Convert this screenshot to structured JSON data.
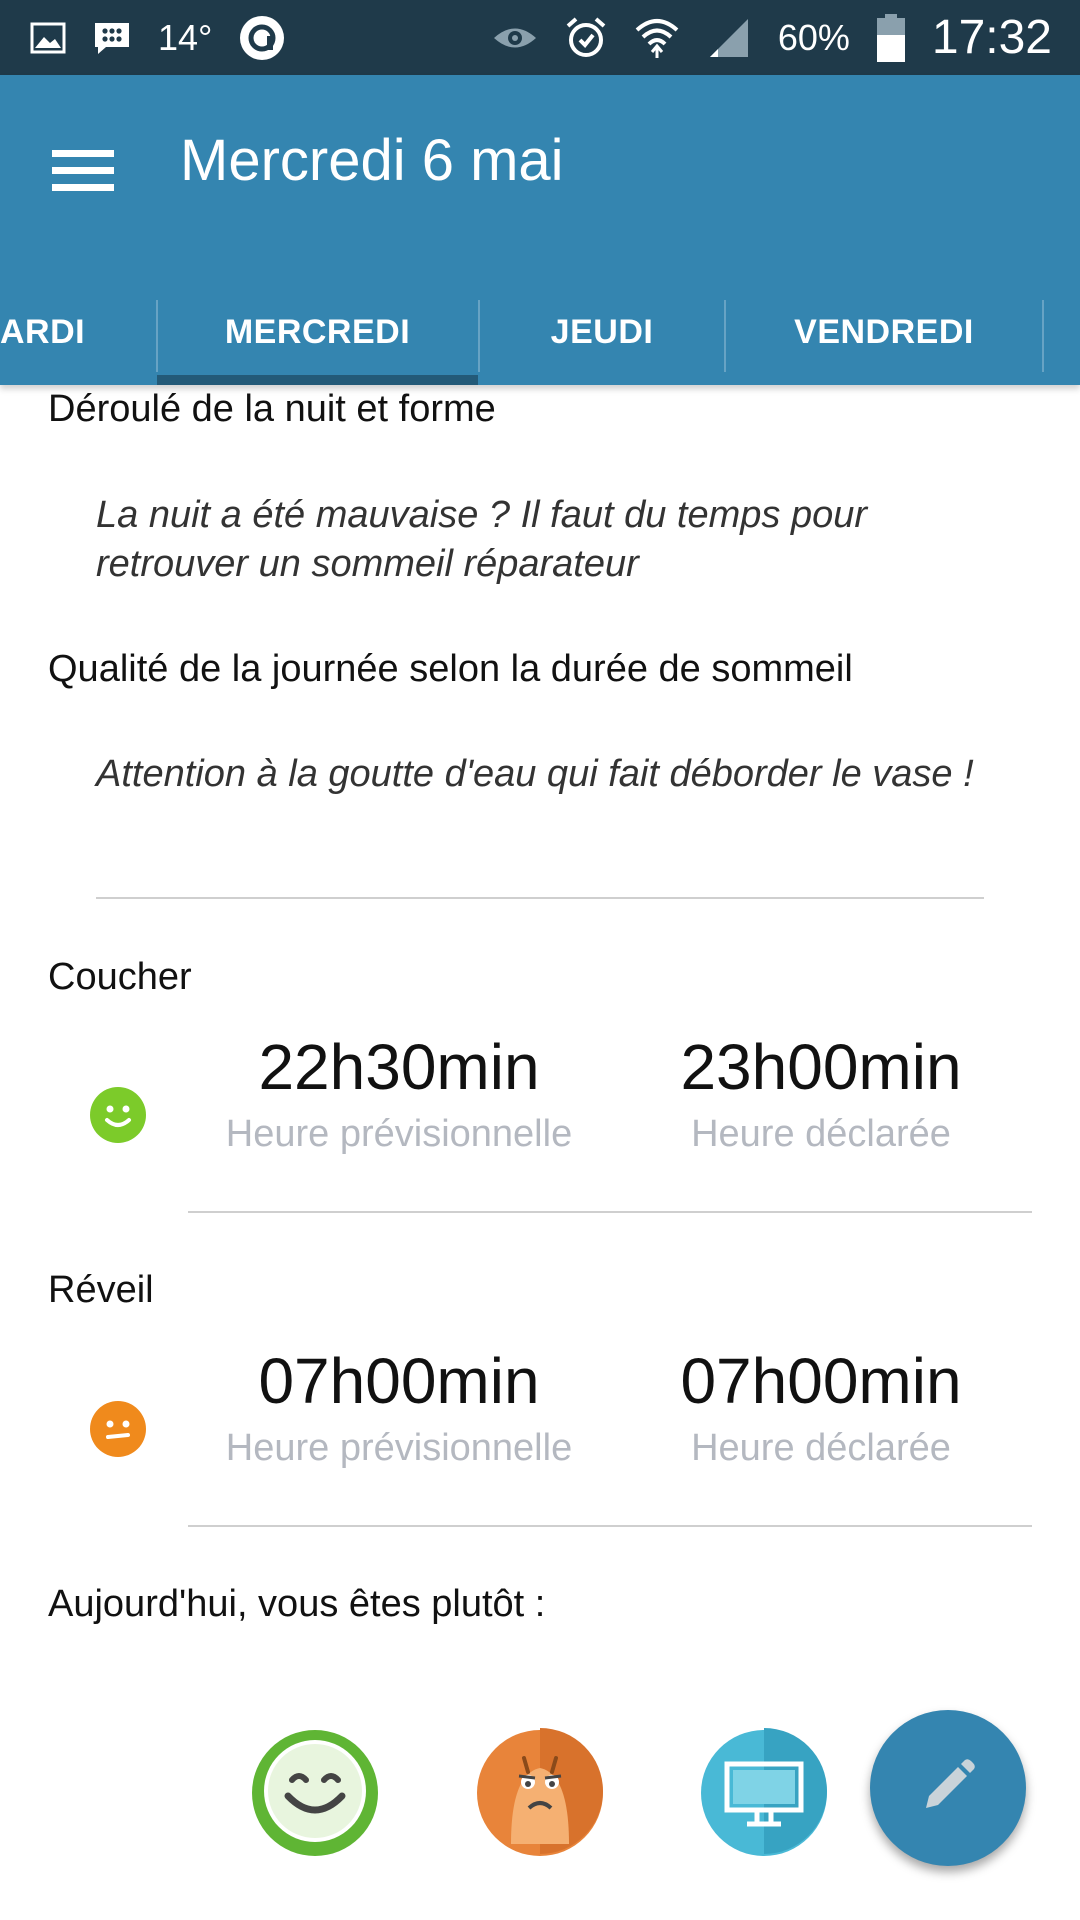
{
  "status_bar": {
    "temperature": "14°",
    "battery": "60%",
    "time": "17:32",
    "icons": [
      "image-icon",
      "bbm-icon",
      "app-circle-icon",
      "eye-icon",
      "alarm-icon",
      "wifi-icon",
      "signal-icon",
      "battery-icon"
    ]
  },
  "app_bar": {
    "title": "Mercredi 6 mai",
    "tabs": [
      {
        "label": "ARDI",
        "selected": false
      },
      {
        "label": "MERCREDI",
        "selected": true
      },
      {
        "label": "JEUDI",
        "selected": false
      },
      {
        "label": "VENDREDI",
        "selected": false
      }
    ]
  },
  "night": {
    "heading": "Déroulé de la nuit et forme",
    "advice": "La nuit a été mauvaise ? Il faut du temps pour retrouver un sommeil réparateur"
  },
  "day_quality": {
    "heading": "Qualité de la journée selon la durée de sommeil",
    "advice": "Attention à la goutte d'eau qui fait déborder le vase !"
  },
  "bedtime": {
    "heading": "Coucher",
    "mood": "happy",
    "mood_color": "#7ccb2a",
    "planned_value": "22h30min",
    "planned_label": "Heure prévisionnelle",
    "declared_value": "23h00min",
    "declared_label": "Heure déclarée"
  },
  "wakeup": {
    "heading": "Réveil",
    "mood": "neutral",
    "mood_color": "#f08a1c",
    "planned_value": "07h00min",
    "planned_label": "Heure prévisionnelle",
    "declared_value": "07h00min",
    "declared_label": "Heure déclarée"
  },
  "today": {
    "heading": "Aujourd'hui, vous êtes plutôt :",
    "options": [
      {
        "icon": "happy-face-icon",
        "color": "#6cc035"
      },
      {
        "icon": "tired-snail-icon",
        "color": "#e87f2e"
      },
      {
        "icon": "screen-icon",
        "color": "#3fb3cf"
      }
    ]
  },
  "fab": {
    "icon": "pencil-icon",
    "color": "#3485b0"
  }
}
